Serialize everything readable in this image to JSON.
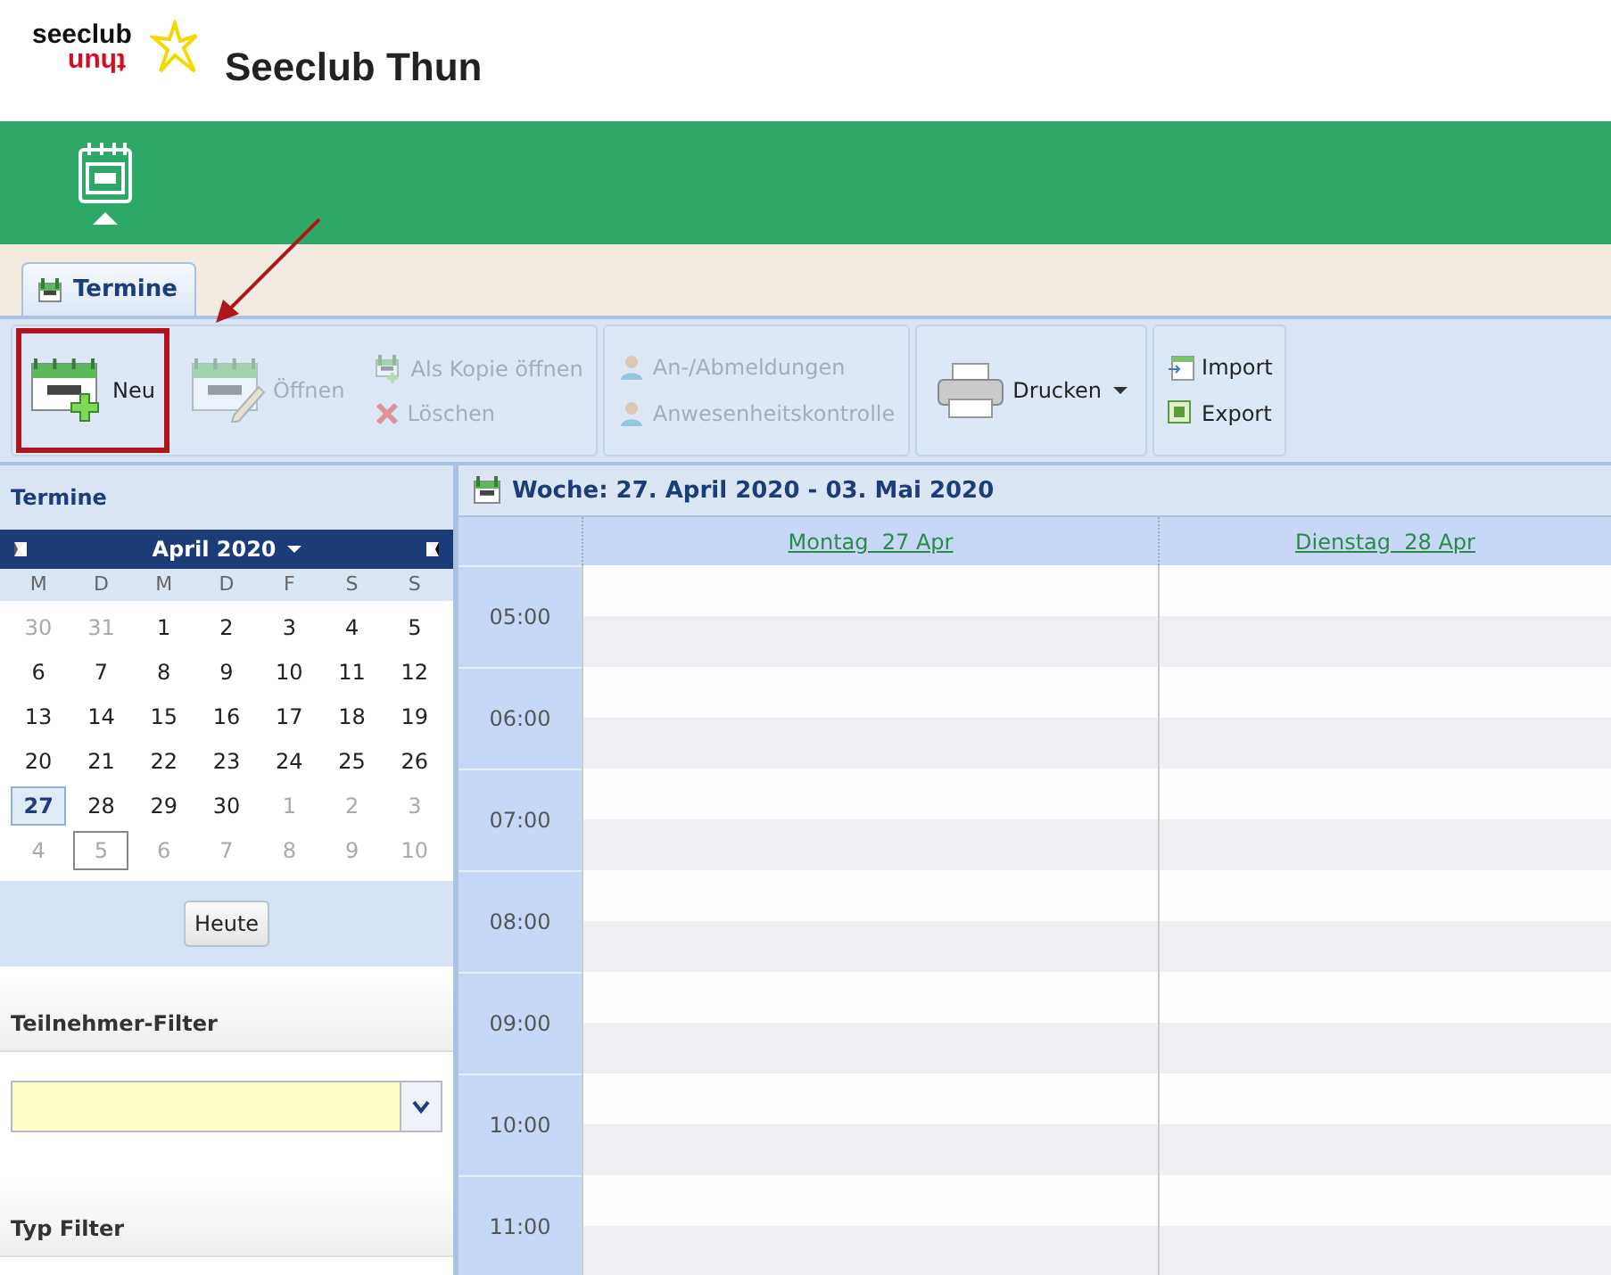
{
  "header": {
    "logo_top": "seeclub",
    "logo_bottom": "thun",
    "title": "Seeclub Thun"
  },
  "module_bar": {
    "items": [
      {
        "kind": "calendar",
        "selected": true
      }
    ]
  },
  "tabs": [
    {
      "label": "Termine",
      "selected": true
    }
  ],
  "toolbar": {
    "groups": [
      {
        "columns": [
          [
            {
              "label": "Neu",
              "kind": "new",
              "disabled": false,
              "highlighted": true
            }
          ],
          [
            {
              "label": "Öffnen",
              "kind": "open",
              "disabled": true,
              "highlighted": false
            }
          ],
          [
            {
              "label": "Als Kopie öffnen",
              "kind": "copy",
              "disabled": true,
              "highlighted": false
            },
            {
              "label": "Löschen",
              "kind": "delete",
              "disabled": true,
              "highlighted": false
            }
          ]
        ]
      },
      {
        "columns": [
          [
            {
              "label": "An-/Abmeldungen",
              "kind": "people",
              "disabled": true,
              "highlighted": false
            },
            {
              "label": "Anwesenheitskontrolle",
              "kind": "people",
              "disabled": true,
              "highlighted": false
            }
          ]
        ]
      },
      {
        "columns": [
          [
            {
              "label": "Drucken",
              "kind": "print",
              "disabled": false,
              "highlighted": false,
              "dropdown": true
            }
          ]
        ]
      },
      {
        "columns": [
          [
            {
              "label": "Import",
              "kind": "import",
              "disabled": false,
              "highlighted": false
            },
            {
              "label": "Export",
              "kind": "export",
              "disabled": false,
              "highlighted": false
            }
          ]
        ]
      }
    ]
  },
  "sidebar": {
    "title": "Termine",
    "mini_calendar": {
      "month": "April 2020",
      "weekdays": [
        "M",
        "D",
        "M",
        "D",
        "F",
        "S",
        "S"
      ],
      "weeks": [
        [
          {
            "day": "30",
            "other_month": true,
            "selected": false,
            "today": false
          },
          {
            "day": "31",
            "other_month": true,
            "selected": false,
            "today": false
          },
          {
            "day": "1",
            "other_month": false,
            "selected": false,
            "today": false
          },
          {
            "day": "2",
            "other_month": false,
            "selected": false,
            "today": false
          },
          {
            "day": "3",
            "other_month": false,
            "selected": false,
            "today": false
          },
          {
            "day": "4",
            "other_month": false,
            "selected": false,
            "today": false
          },
          {
            "day": "5",
            "other_month": false,
            "selected": false,
            "today": false
          }
        ],
        [
          {
            "day": "6",
            "other_month": false,
            "selected": false,
            "today": false
          },
          {
            "day": "7",
            "other_month": false,
            "selected": false,
            "today": false
          },
          {
            "day": "8",
            "other_month": false,
            "selected": false,
            "today": false
          },
          {
            "day": "9",
            "other_month": false,
            "selected": false,
            "today": false
          },
          {
            "day": "10",
            "other_month": false,
            "selected": false,
            "today": false
          },
          {
            "day": "11",
            "other_month": false,
            "selected": false,
            "today": false
          },
          {
            "day": "12",
            "other_month": false,
            "selected": false,
            "today": false
          }
        ],
        [
          {
            "day": "13",
            "other_month": false,
            "selected": false,
            "today": false
          },
          {
            "day": "14",
            "other_month": false,
            "selected": false,
            "today": false
          },
          {
            "day": "15",
            "other_month": false,
            "selected": false,
            "today": false
          },
          {
            "day": "16",
            "other_month": false,
            "selected": false,
            "today": false
          },
          {
            "day": "17",
            "other_month": false,
            "selected": false,
            "today": false
          },
          {
            "day": "18",
            "other_month": false,
            "selected": false,
            "today": false
          },
          {
            "day": "19",
            "other_month": false,
            "selected": false,
            "today": false
          }
        ],
        [
          {
            "day": "20",
            "other_month": false,
            "selected": false,
            "today": false
          },
          {
            "day": "21",
            "other_month": false,
            "selected": false,
            "today": false
          },
          {
            "day": "22",
            "other_month": false,
            "selected": false,
            "today": false
          },
          {
            "day": "23",
            "other_month": false,
            "selected": false,
            "today": false
          },
          {
            "day": "24",
            "other_month": false,
            "selected": false,
            "today": false
          },
          {
            "day": "25",
            "other_month": false,
            "selected": false,
            "today": false
          },
          {
            "day": "26",
            "other_month": false,
            "selected": false,
            "today": false
          }
        ],
        [
          {
            "day": "27",
            "other_month": false,
            "selected": true,
            "today": false
          },
          {
            "day": "28",
            "other_month": false,
            "selected": false,
            "today": false
          },
          {
            "day": "29",
            "other_month": false,
            "selected": false,
            "today": false
          },
          {
            "day": "30",
            "other_month": false,
            "selected": false,
            "today": false
          },
          {
            "day": "1",
            "other_month": true,
            "selected": false,
            "today": false
          },
          {
            "day": "2",
            "other_month": true,
            "selected": false,
            "today": false
          },
          {
            "day": "3",
            "other_month": true,
            "selected": false,
            "today": false
          }
        ],
        [
          {
            "day": "4",
            "other_month": true,
            "selected": false,
            "today": false
          },
          {
            "day": "5",
            "other_month": true,
            "selected": false,
            "today": true
          },
          {
            "day": "6",
            "other_month": true,
            "selected": false,
            "today": false
          },
          {
            "day": "7",
            "other_month": true,
            "selected": false,
            "today": false
          },
          {
            "day": "8",
            "other_month": true,
            "selected": false,
            "today": false
          },
          {
            "day": "9",
            "other_month": true,
            "selected": false,
            "today": false
          },
          {
            "day": "10",
            "other_month": true,
            "selected": false,
            "today": false
          }
        ]
      ],
      "today_button": "Heute"
    },
    "participant_filter": {
      "title": "Teilnehmer-Filter"
    },
    "type_filter": {
      "title": "Typ Filter"
    }
  },
  "week_view": {
    "title": "Woche: 27. April 2020 - 03. Mai 2020",
    "days": [
      "Montag  27 Apr",
      "Dienstag  28 Apr"
    ],
    "hours": [
      "05:00",
      "06:00",
      "07:00",
      "08:00",
      "09:00",
      "10:00",
      "11:00"
    ]
  }
}
